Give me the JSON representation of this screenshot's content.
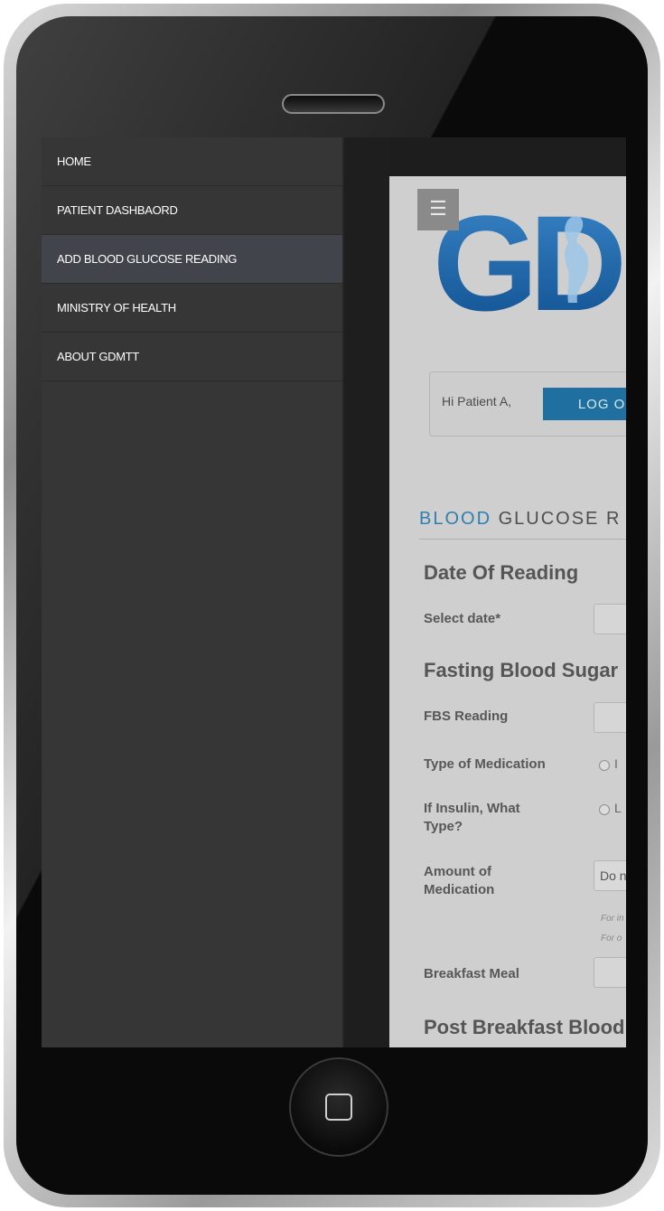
{
  "menu": {
    "items": [
      {
        "label": "HOME"
      },
      {
        "label": "PATIENT DASHBAORD"
      },
      {
        "label": "ADD BLOOD GLUCOSE READING"
      },
      {
        "label": "MINISTRY OF HEALTH"
      },
      {
        "label": "ABOUT GDMTT"
      }
    ],
    "active_index": 2
  },
  "header": {
    "hamburger_icon": "hamburger-icon",
    "logo_text": "GD"
  },
  "greeting": {
    "text": "Hi Patient A,",
    "logout_label": "LOG OU"
  },
  "section": {
    "title_accent": "BLOOD",
    "title_rest": " GLUCOSE R"
  },
  "form": {
    "date_heading": "Date Of Reading",
    "select_date_label": "Select date*",
    "fasting_heading": "Fasting Blood Sugar",
    "fbs_label": "FBS Reading",
    "medication_type_label": "Type of Medication",
    "medication_type_option": "I",
    "insulin_type_label": "If Insulin, What Type?",
    "insulin_type_option": "L",
    "amount_label": "Amount of Medication",
    "amount_select_value": "Do n",
    "hint_1": "For in",
    "hint_2": "For o",
    "breakfast_label": "Breakfast Meal",
    "post_breakfast_heading": "Post Breakfast Blood"
  },
  "colors": {
    "menu_bg": "#363636",
    "menu_active_bg": "#41454b",
    "accent_blue": "#2f7fb0",
    "button_blue": "#1f6fa0",
    "logo_blue": "#1a63a8"
  }
}
